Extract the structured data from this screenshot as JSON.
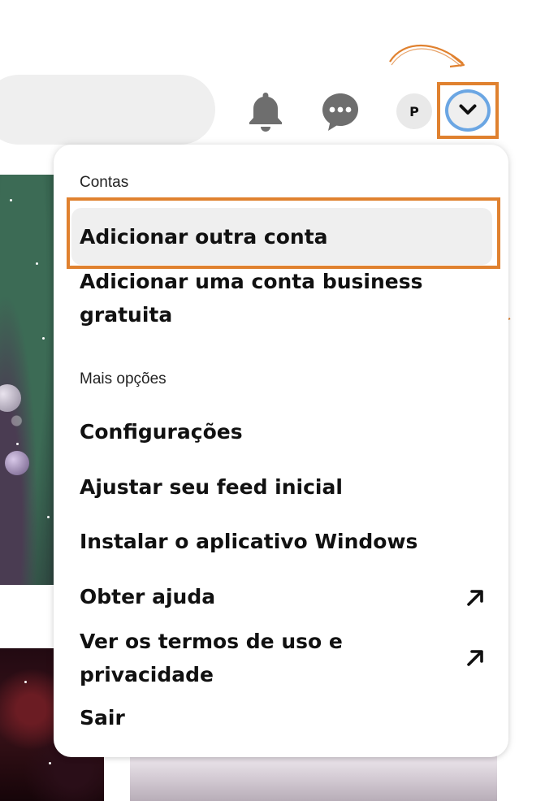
{
  "header": {
    "avatar_initial": "P",
    "icons": [
      "bell-icon",
      "chat-icon",
      "chevron-down-icon"
    ]
  },
  "menu": {
    "section_accounts": "Contas",
    "add_account": "Adicionar outra conta",
    "add_business_line1": "Adicionar uma conta business",
    "add_business_line2": "gratuita",
    "section_more": "Mais opções",
    "settings": "Configurações",
    "tune_feed": "Ajustar seu feed inicial",
    "install_app": "Instalar o aplicativo Windows",
    "get_help": "Obter ajuda",
    "terms_line1": "Ver os termos de uso e",
    "terms_line2": "privacidade",
    "logout": "Sair"
  },
  "colors": {
    "highlight_frame": "#e0812f",
    "focus_ring": "#6ba6e3",
    "menu_hover": "#efefef"
  }
}
